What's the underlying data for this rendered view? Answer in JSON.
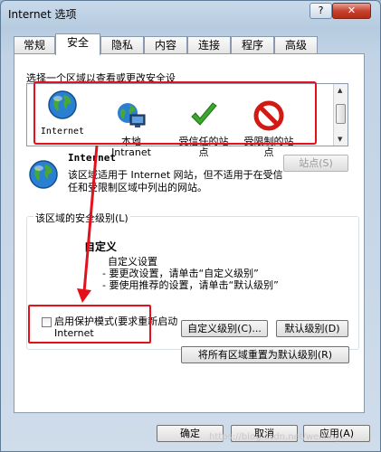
{
  "window": {
    "title": "Internet 选项",
    "help_label": "?",
    "close_label": "✕"
  },
  "tabs": [
    "常规",
    "安全",
    "隐私",
    "内容",
    "连接",
    "程序",
    "高级"
  ],
  "zones": {
    "caption": "选择一个区域以查看或更改安全设",
    "items": [
      {
        "label": "Internet",
        "icon": "globe-icon"
      },
      {
        "label": "本地\nIntranet",
        "icon": "intranet-icon"
      },
      {
        "label": "受信任的站\n点",
        "icon": "checkmark-icon"
      },
      {
        "label": "受限制的站\n点",
        "icon": "restricted-icon"
      }
    ]
  },
  "selected_zone": {
    "title": "Internet",
    "description": "该区域适用于 Internet 网站，但不适用于在受信任和受限制区域中列出的网站。",
    "sites_button": "站点(S)"
  },
  "security_level": {
    "group_label": "该区域的安全级别(L)",
    "custom_title": "自定义",
    "custom_lines": [
      "自定义设置",
      " - 要更改设置，请单击“自定义级别”",
      " - 要使用推荐的设置，请单击“默认级别”"
    ],
    "protected_mode_label": "启用保护模式(要求重新启动 Internet",
    "protected_mode_checked": false,
    "custom_level_button": "自定义级别(C)...",
    "default_level_button": "默认级别(D)",
    "reset_all_button": "将所有区域重置为默认级别(R)"
  },
  "footer": {
    "ok_button": "确定",
    "cancel_button": "取消",
    "apply_button": "应用(A)"
  },
  "watermark": "https://blog.csdn.net/weixin_...",
  "colors": {
    "highlight_red": "#e3111b",
    "titlebar_blue": "#b6cbe0"
  }
}
